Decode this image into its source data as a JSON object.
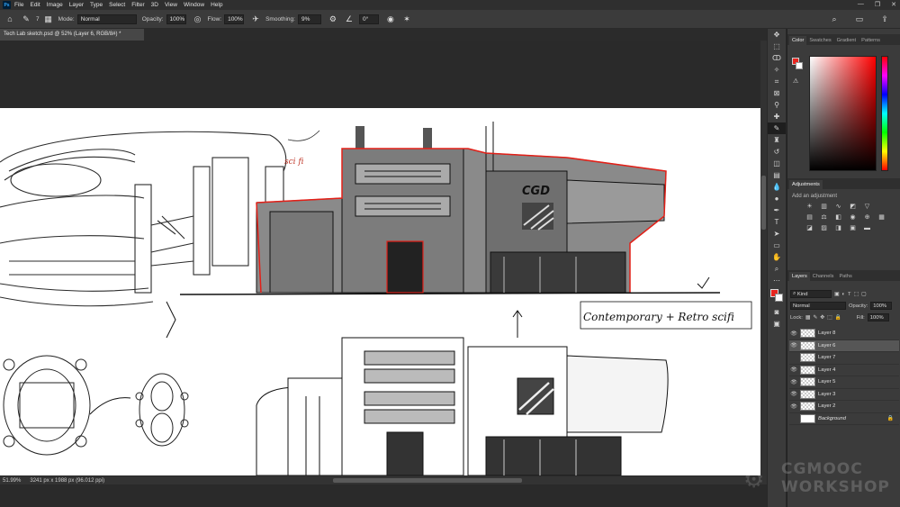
{
  "app": {
    "logo": "Ps",
    "menu": [
      "File",
      "Edit",
      "Image",
      "Layer",
      "Type",
      "Select",
      "Filter",
      "3D",
      "View",
      "Window",
      "Help"
    ],
    "window_controls": [
      "—",
      "❐",
      "✕"
    ]
  },
  "options": {
    "brush_size": "7",
    "mode_label": "Mode:",
    "mode_value": "Normal",
    "opacity_label": "Opacity:",
    "opacity_value": "100%",
    "flow_label": "Flow:",
    "flow_value": "100%",
    "smoothing_label": "Smoothing:",
    "smoothing_value": "9%",
    "angle_value": "0°"
  },
  "document": {
    "tab_title": "Tech Lab sketch.psd @ 52% (Layer 6, RGB/8#) *",
    "canvas_annotations": {
      "cgd": "CGD",
      "note_left": "sci fi",
      "note_right": "Contemporary + Retro scifi"
    }
  },
  "status": {
    "zoom": "51.99%",
    "doc_size": "3241 px x 1988 px (96.012 ppi)"
  },
  "panels": {
    "color_tabs": [
      "Color",
      "Swatches",
      "Gradient",
      "Patterns"
    ],
    "adjustments_title": "Adjustments",
    "adjustments_hint": "Add an adjustment",
    "layers_tabs": [
      "Layers",
      "Channels",
      "Paths"
    ],
    "kind_filter": "Kind",
    "blend_mode": "Normal",
    "opacity_label": "Opacity:",
    "opacity_value": "100%",
    "lock_label": "Lock:",
    "fill_label": "Fill:",
    "fill_value": "100%",
    "layers": [
      {
        "name": "Layer 8",
        "visible": true
      },
      {
        "name": "Layer 6",
        "visible": true,
        "selected": true
      },
      {
        "name": "Layer 7",
        "visible": false
      },
      {
        "name": "Layer 4",
        "visible": true
      },
      {
        "name": "Layer 5",
        "visible": true
      },
      {
        "name": "Layer 3",
        "visible": true
      },
      {
        "name": "Layer 2",
        "visible": true
      },
      {
        "name": "Background",
        "visible": false,
        "background": true
      }
    ]
  },
  "watermark": {
    "line1": "CGMOOC",
    "line2": "WORKSHOP"
  },
  "colors": {
    "foreground": "#e8251f",
    "background": "#ffffff",
    "accent_red": "#e32018"
  }
}
